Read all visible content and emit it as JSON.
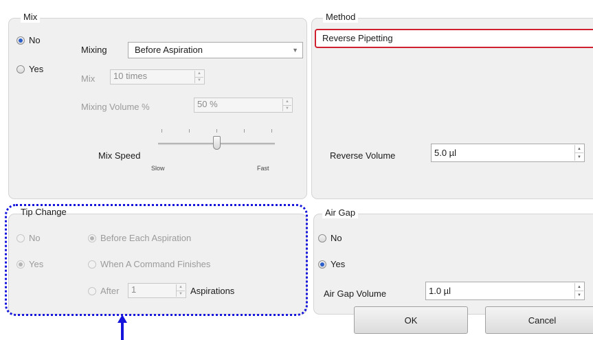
{
  "mix": {
    "title": "Mix",
    "no_label": "No",
    "yes_label": "Yes",
    "selected": "No",
    "mixing_label": "Mixing",
    "mixing_value": "Before Aspiration",
    "mix_label": "Mix",
    "mix_value": "10 times",
    "volume_label": "Mixing Volume %",
    "volume_value": "50 %",
    "speed_label": "Mix Speed",
    "speed_slow": "Slow",
    "speed_fast": "Fast",
    "speed_level": 0.5
  },
  "method": {
    "title": "Method",
    "value": "Reverse Pipetting",
    "reverse_volume_label": "Reverse Volume",
    "reverse_volume_value": "5.0 µl"
  },
  "tip_change": {
    "title": "Tip Change",
    "no_label": "No",
    "yes_label": "Yes",
    "selected": "Yes",
    "before_each_label": "Before Each Aspiration",
    "when_finishes_label": "When A Command Finishes",
    "after_label": "After",
    "after_value": "1",
    "aspirations_label": "Aspirations",
    "option_selected": "Before Each Aspiration"
  },
  "air_gap": {
    "title": "Air Gap",
    "no_label": "No",
    "yes_label": "Yes",
    "selected": "Yes",
    "volume_label": "Air Gap Volume",
    "volume_value": "1.0 µl"
  },
  "buttons": {
    "ok": "OK",
    "cancel": "Cancel"
  },
  "colors": {
    "highlight_red": "#d01f2f",
    "annotation_blue": "#1414dc",
    "radio_accent": "#2c5fc9"
  }
}
